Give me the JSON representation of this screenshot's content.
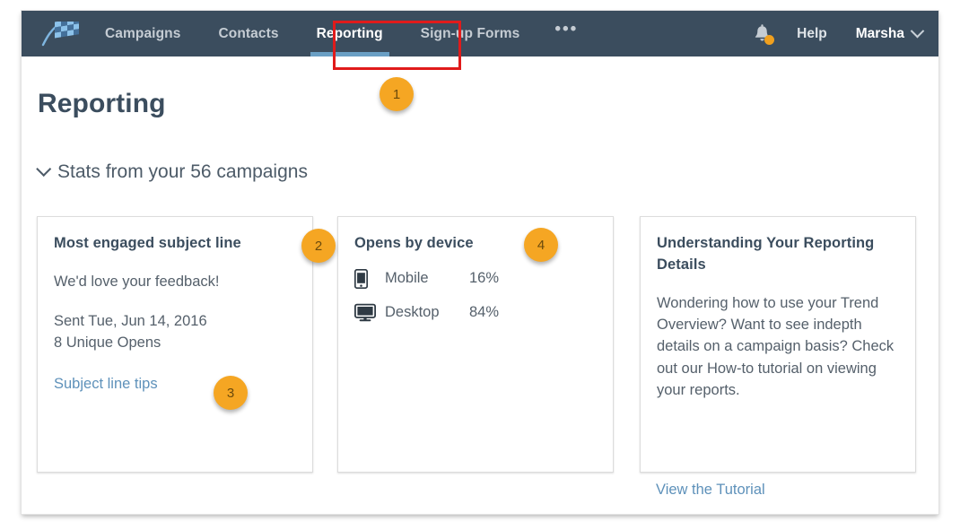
{
  "navbar": {
    "logo_icon": "checkered-flag-logo",
    "links": [
      {
        "label": "Campaigns",
        "active": false
      },
      {
        "label": "Contacts",
        "active": false
      },
      {
        "label": "Reporting",
        "active": true
      },
      {
        "label": "Sign-up Forms",
        "active": false
      }
    ],
    "more_label": "•••",
    "bell_icon": "notification-bell-icon",
    "help_label": "Help",
    "user_label": "Marsha",
    "bar_color": "#3b4d5e",
    "active_underline_color": "#6a9fc4",
    "bell_badge_color": "#f0a01e"
  },
  "page": {
    "title": "Reporting",
    "stats_line": "Stats from your 56 campaigns",
    "campaign_count": 56
  },
  "cards": {
    "subject_line": {
      "title": "Most engaged subject line",
      "subject": "We'd love your feedback!",
      "sent": "Sent Tue, Jun 14, 2016",
      "unique_opens": "8 Unique Opens",
      "link_label": "Subject line tips"
    },
    "opens_by_device": {
      "title": "Opens by device",
      "rows": [
        {
          "icon": "mobile-phone-icon",
          "label": "Mobile",
          "value": "16%"
        },
        {
          "icon": "desktop-monitor-icon",
          "label": "Desktop",
          "value": "84%"
        }
      ]
    },
    "understanding": {
      "title": "Understanding Your Reporting Details",
      "body": "Wondering how to use your Trend Overview? Want to see indepth details on a campaign basis? Check out our How-to tutorial on viewing your reports.",
      "link_label": "View the Tutorial"
    }
  },
  "annotations": {
    "badge_color": "#f5a623",
    "highlight_color": "#e01b1b",
    "badges": [
      {
        "number": "1",
        "target": "reporting-nav-tab"
      },
      {
        "number": "2",
        "target": "most-engaged-subject-line-card"
      },
      {
        "number": "3",
        "target": "subject-line-tips-link"
      },
      {
        "number": "4",
        "target": "opens-by-device-card"
      }
    ]
  }
}
